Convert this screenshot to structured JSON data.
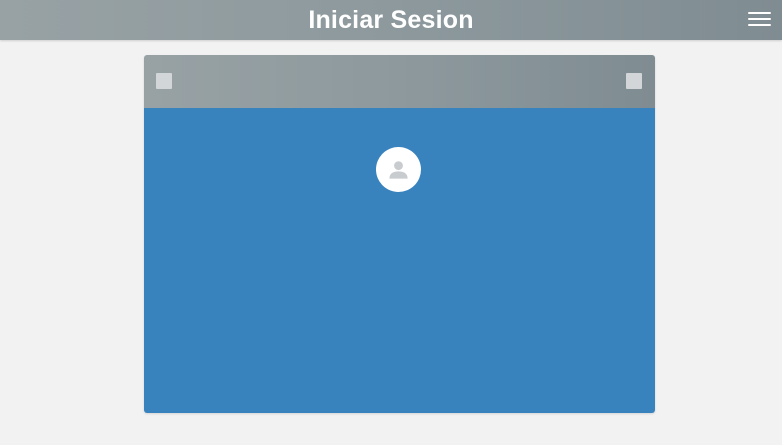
{
  "header": {
    "title": "Iniciar Sesion",
    "menu_icon": "hamburger-menu-icon"
  },
  "card": {
    "header_left_icon": "square-placeholder-icon",
    "header_right_icon": "square-placeholder-icon",
    "avatar_icon": "user-avatar-icon"
  },
  "colors": {
    "topbar": "#8d999d",
    "card_body": "#3882be",
    "background": "#f2f2f2",
    "avatar_bg": "#ffffff",
    "avatar_glyph": "#c8cccf"
  }
}
